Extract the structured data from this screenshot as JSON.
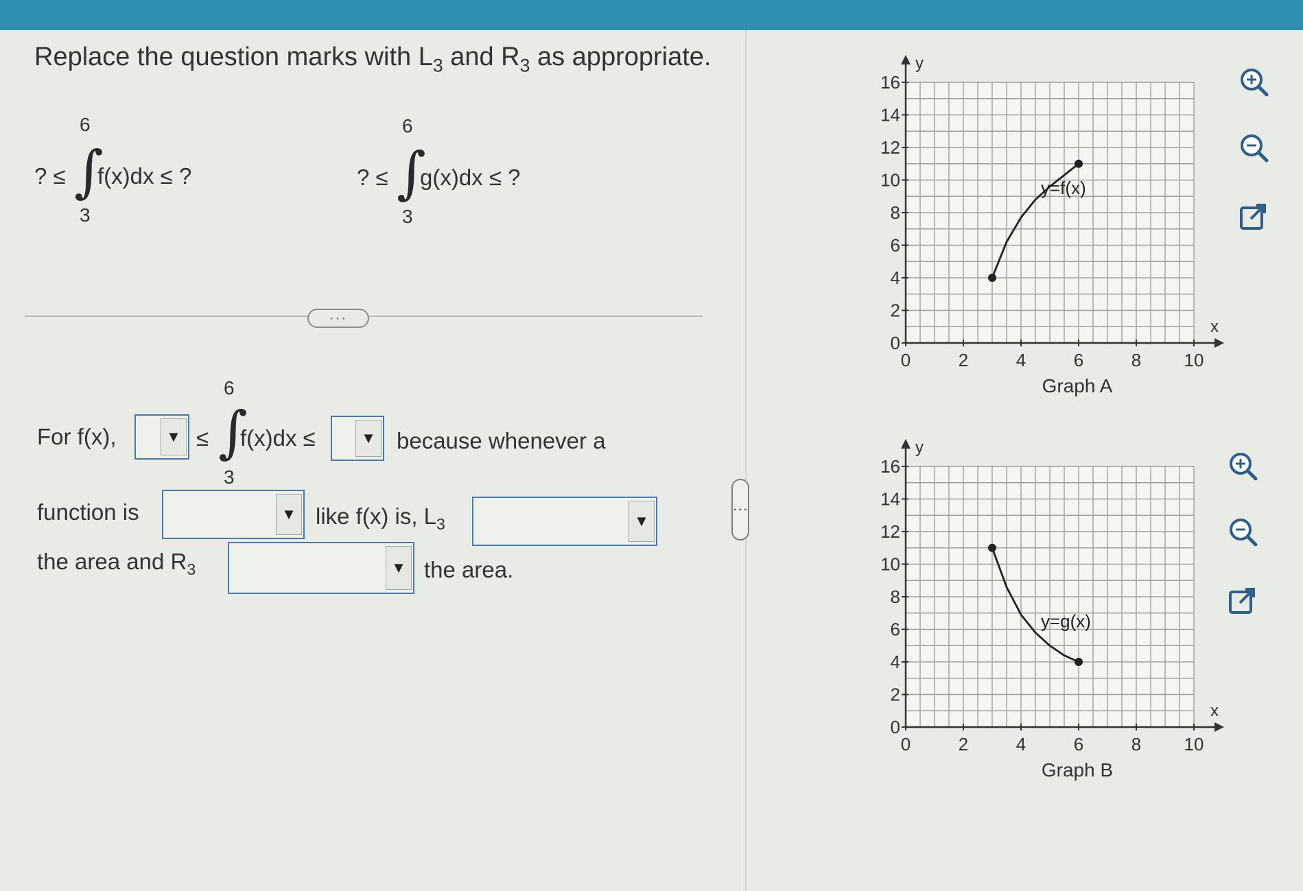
{
  "instruction": {
    "text_pre": "Replace the question marks with L",
    "sub1": "3",
    "text_mid": " and R",
    "sub2": "3",
    "text_post": " as appropriate."
  },
  "integral_f": {
    "lhs": "? ≤",
    "upper": "6",
    "lower": "3",
    "integrand": "f(x)dx ≤ ?"
  },
  "integral_g": {
    "lhs": "? ≤",
    "upper": "6",
    "lower": "3",
    "integrand": "g(x)dx ≤ ?"
  },
  "expander": {
    "label": "···"
  },
  "answer": {
    "for_label": "For f(x),",
    "le1": "≤",
    "upper": "6",
    "lower": "3",
    "integrand": "f(x)dx ≤",
    "because": "because whenever a",
    "function_is": "function is",
    "like_f": "like f(x) is, L",
    "like_sub": "3",
    "area_and": "the area and R",
    "area_sub": "3",
    "the_area": "the area.",
    "dropdown_values": {
      "d1": "",
      "d2": "",
      "d3": "",
      "d4": "",
      "d5": ""
    }
  },
  "pane_handle": {
    "label": "⋮"
  },
  "tools": {
    "top": [
      "zoom-in-icon",
      "zoom-out-icon",
      "external-link-icon"
    ],
    "bottom": [
      "zoom-in-icon",
      "zoom-out-icon",
      "external-link-icon"
    ]
  },
  "chart_data": [
    {
      "type": "line",
      "title": "Graph A",
      "xlabel": "x",
      "ylabel": "y",
      "xlim": [
        0,
        10
      ],
      "ylim": [
        0,
        16
      ],
      "x_ticks": [
        "0",
        "2",
        "4",
        "6",
        "8",
        "10"
      ],
      "y_ticks": [
        "0",
        "2",
        "4",
        "6",
        "8",
        "10",
        "12",
        "14",
        "16"
      ],
      "grid": true,
      "series": [
        {
          "name": "y=f(x)",
          "x": [
            3,
            3.5,
            4,
            4.5,
            5,
            5.5,
            6
          ],
          "y": [
            4,
            6.2,
            7.7,
            8.8,
            9.6,
            10.3,
            11
          ]
        }
      ],
      "endpoints": [
        [
          3,
          4
        ],
        [
          6,
          11
        ]
      ]
    },
    {
      "type": "line",
      "title": "Graph B",
      "xlabel": "x",
      "ylabel": "y",
      "xlim": [
        0,
        10
      ],
      "ylim": [
        0,
        16
      ],
      "x_ticks": [
        "0",
        "2",
        "4",
        "6",
        "8",
        "10"
      ],
      "y_ticks": [
        "0",
        "2",
        "4",
        "6",
        "8",
        "10",
        "12",
        "14",
        "16"
      ],
      "grid": true,
      "series": [
        {
          "name": "y=g(x)",
          "x": [
            3,
            3.5,
            4,
            4.5,
            5,
            5.5,
            6
          ],
          "y": [
            11,
            8.6,
            6.9,
            5.8,
            5,
            4.4,
            4
          ]
        }
      ],
      "endpoints": [
        [
          3,
          11
        ],
        [
          6,
          4
        ]
      ]
    }
  ]
}
